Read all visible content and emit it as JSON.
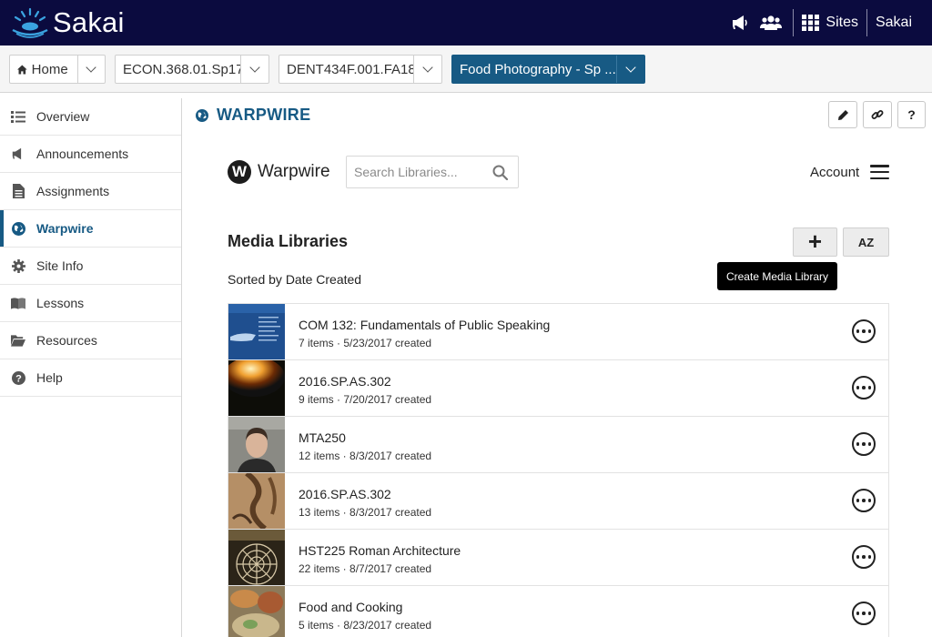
{
  "topbar": {
    "logo_text": "Sakai",
    "sites_label": "Sites",
    "user_label": "Sakai",
    "background": "#0b0b3f"
  },
  "site_tabs": [
    {
      "label": "Home",
      "icon": "home-icon"
    },
    {
      "label": "ECON.368.01.Sp17"
    },
    {
      "label": "DENT434F.001.FA18"
    },
    {
      "label": "Food Photography - Sp ...",
      "active": true
    }
  ],
  "tools": [
    {
      "label": "Overview",
      "icon": "list-icon"
    },
    {
      "label": "Announcements",
      "icon": "megaphone-icon"
    },
    {
      "label": "Assignments",
      "icon": "document-icon"
    },
    {
      "label": "Warpwire",
      "icon": "globe-icon",
      "active": true
    },
    {
      "label": "Site Info",
      "icon": "gear-icon"
    },
    {
      "label": "Lessons",
      "icon": "book-icon"
    },
    {
      "label": "Resources",
      "icon": "folder-icon"
    },
    {
      "label": "Help",
      "icon": "question-circle-icon"
    }
  ],
  "main": {
    "tool_title": "WARPWIRE",
    "help_label": "?"
  },
  "warpwire": {
    "logo_letter": "W",
    "name": "Warpwire",
    "search_placeholder": "Search Libraries...",
    "account_label": "Account",
    "section_title": "Media Libraries",
    "sorted_label": "Sorted by Date Created",
    "add_label": "+",
    "sort_label": "AZ",
    "tooltip": "Create Media Library",
    "libraries": [
      {
        "title": "COM 132: Fundamentals of Public Speaking",
        "meta": "7 items · 5/23/2017 created"
      },
      {
        "title": "2016.SP.AS.302",
        "meta": "9 items · 7/20/2017 created"
      },
      {
        "title": "MTA250",
        "meta": "12 items · 8/3/2017 created"
      },
      {
        "title": "2016.SP.AS.302",
        "meta": "13 items · 8/3/2017 created"
      },
      {
        "title": "HST225 Roman Architecture",
        "meta": "22 items · 8/7/2017 created"
      },
      {
        "title": "Food and Cooking",
        "meta": "5 items · 8/23/2017 created"
      }
    ]
  },
  "colors": {
    "accent": "#175a84",
    "topbar": "#0b0b3f"
  }
}
